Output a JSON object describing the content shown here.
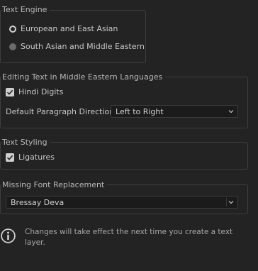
{
  "text_engine": {
    "title": "Text Engine",
    "options": [
      {
        "label": "European and East Asian",
        "selected": true
      },
      {
        "label": "South Asian and Middle Eastern",
        "selected": false
      }
    ]
  },
  "middle_eastern": {
    "title": "Editing Text in Middle Eastern Languages",
    "hindi_digits": {
      "label": "Hindi Digits",
      "checked": true
    },
    "paragraph_direction": {
      "label": "Default Paragraph Direction:",
      "value": "Left to Right"
    }
  },
  "text_styling": {
    "title": "Text Styling",
    "ligatures": {
      "label": "Ligatures",
      "checked": true
    }
  },
  "missing_font": {
    "title": "Missing Font Replacement",
    "value": "Bressay Deva"
  },
  "info": {
    "icon": "info-icon",
    "message": "Changes will take effect the next time you create a text layer."
  }
}
